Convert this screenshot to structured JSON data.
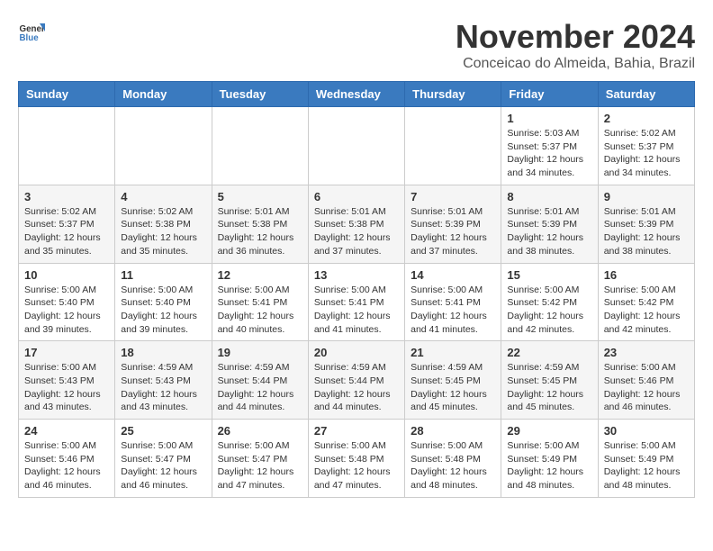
{
  "logo": {
    "general": "General",
    "blue": "Blue"
  },
  "title": "November 2024",
  "location": "Conceicao do Almeida, Bahia, Brazil",
  "weekdays": [
    "Sunday",
    "Monday",
    "Tuesday",
    "Wednesday",
    "Thursday",
    "Friday",
    "Saturday"
  ],
  "weeks": [
    [
      {
        "day": "",
        "info": ""
      },
      {
        "day": "",
        "info": ""
      },
      {
        "day": "",
        "info": ""
      },
      {
        "day": "",
        "info": ""
      },
      {
        "day": "",
        "info": ""
      },
      {
        "day": "1",
        "info": "Sunrise: 5:03 AM\nSunset: 5:37 PM\nDaylight: 12 hours\nand 34 minutes."
      },
      {
        "day": "2",
        "info": "Sunrise: 5:02 AM\nSunset: 5:37 PM\nDaylight: 12 hours\nand 34 minutes."
      }
    ],
    [
      {
        "day": "3",
        "info": "Sunrise: 5:02 AM\nSunset: 5:37 PM\nDaylight: 12 hours\nand 35 minutes."
      },
      {
        "day": "4",
        "info": "Sunrise: 5:02 AM\nSunset: 5:38 PM\nDaylight: 12 hours\nand 35 minutes."
      },
      {
        "day": "5",
        "info": "Sunrise: 5:01 AM\nSunset: 5:38 PM\nDaylight: 12 hours\nand 36 minutes."
      },
      {
        "day": "6",
        "info": "Sunrise: 5:01 AM\nSunset: 5:38 PM\nDaylight: 12 hours\nand 37 minutes."
      },
      {
        "day": "7",
        "info": "Sunrise: 5:01 AM\nSunset: 5:39 PM\nDaylight: 12 hours\nand 37 minutes."
      },
      {
        "day": "8",
        "info": "Sunrise: 5:01 AM\nSunset: 5:39 PM\nDaylight: 12 hours\nand 38 minutes."
      },
      {
        "day": "9",
        "info": "Sunrise: 5:01 AM\nSunset: 5:39 PM\nDaylight: 12 hours\nand 38 minutes."
      }
    ],
    [
      {
        "day": "10",
        "info": "Sunrise: 5:00 AM\nSunset: 5:40 PM\nDaylight: 12 hours\nand 39 minutes."
      },
      {
        "day": "11",
        "info": "Sunrise: 5:00 AM\nSunset: 5:40 PM\nDaylight: 12 hours\nand 39 minutes."
      },
      {
        "day": "12",
        "info": "Sunrise: 5:00 AM\nSunset: 5:41 PM\nDaylight: 12 hours\nand 40 minutes."
      },
      {
        "day": "13",
        "info": "Sunrise: 5:00 AM\nSunset: 5:41 PM\nDaylight: 12 hours\nand 41 minutes."
      },
      {
        "day": "14",
        "info": "Sunrise: 5:00 AM\nSunset: 5:41 PM\nDaylight: 12 hours\nand 41 minutes."
      },
      {
        "day": "15",
        "info": "Sunrise: 5:00 AM\nSunset: 5:42 PM\nDaylight: 12 hours\nand 42 minutes."
      },
      {
        "day": "16",
        "info": "Sunrise: 5:00 AM\nSunset: 5:42 PM\nDaylight: 12 hours\nand 42 minutes."
      }
    ],
    [
      {
        "day": "17",
        "info": "Sunrise: 5:00 AM\nSunset: 5:43 PM\nDaylight: 12 hours\nand 43 minutes."
      },
      {
        "day": "18",
        "info": "Sunrise: 4:59 AM\nSunset: 5:43 PM\nDaylight: 12 hours\nand 43 minutes."
      },
      {
        "day": "19",
        "info": "Sunrise: 4:59 AM\nSunset: 5:44 PM\nDaylight: 12 hours\nand 44 minutes."
      },
      {
        "day": "20",
        "info": "Sunrise: 4:59 AM\nSunset: 5:44 PM\nDaylight: 12 hours\nand 44 minutes."
      },
      {
        "day": "21",
        "info": "Sunrise: 4:59 AM\nSunset: 5:45 PM\nDaylight: 12 hours\nand 45 minutes."
      },
      {
        "day": "22",
        "info": "Sunrise: 4:59 AM\nSunset: 5:45 PM\nDaylight: 12 hours\nand 45 minutes."
      },
      {
        "day": "23",
        "info": "Sunrise: 5:00 AM\nSunset: 5:46 PM\nDaylight: 12 hours\nand 46 minutes."
      }
    ],
    [
      {
        "day": "24",
        "info": "Sunrise: 5:00 AM\nSunset: 5:46 PM\nDaylight: 12 hours\nand 46 minutes."
      },
      {
        "day": "25",
        "info": "Sunrise: 5:00 AM\nSunset: 5:47 PM\nDaylight: 12 hours\nand 46 minutes."
      },
      {
        "day": "26",
        "info": "Sunrise: 5:00 AM\nSunset: 5:47 PM\nDaylight: 12 hours\nand 47 minutes."
      },
      {
        "day": "27",
        "info": "Sunrise: 5:00 AM\nSunset: 5:48 PM\nDaylight: 12 hours\nand 47 minutes."
      },
      {
        "day": "28",
        "info": "Sunrise: 5:00 AM\nSunset: 5:48 PM\nDaylight: 12 hours\nand 48 minutes."
      },
      {
        "day": "29",
        "info": "Sunrise: 5:00 AM\nSunset: 5:49 PM\nDaylight: 12 hours\nand 48 minutes."
      },
      {
        "day": "30",
        "info": "Sunrise: 5:00 AM\nSunset: 5:49 PM\nDaylight: 12 hours\nand 48 minutes."
      }
    ]
  ]
}
